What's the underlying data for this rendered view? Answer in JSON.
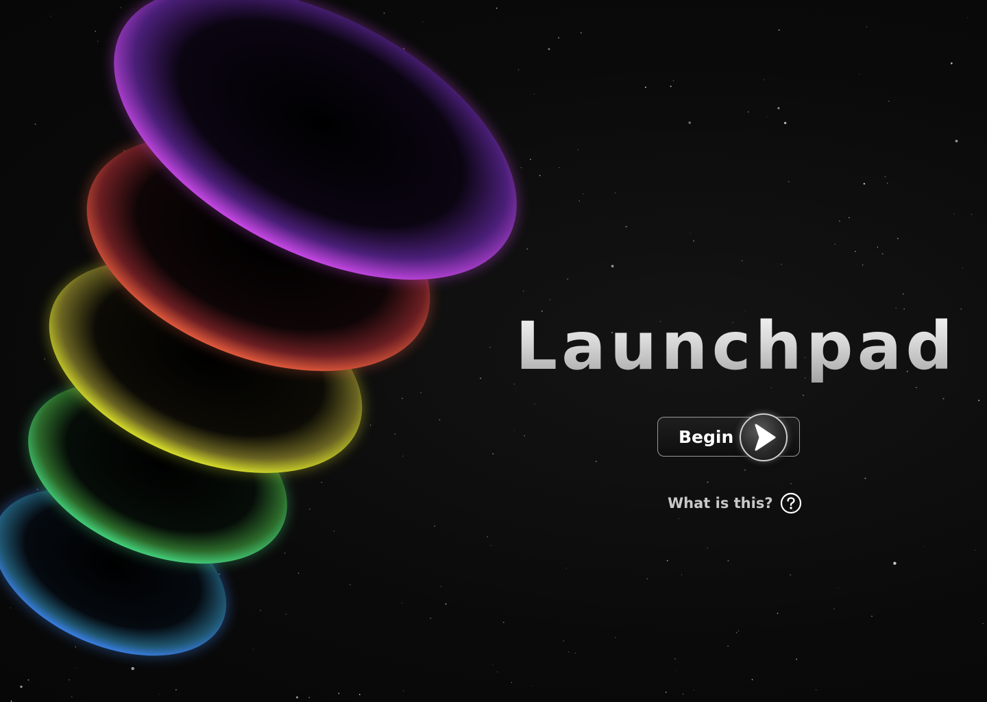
{
  "app": {
    "title": "Launchpad"
  },
  "actions": {
    "begin_label": "Begin",
    "help_label": "What is this?"
  },
  "icons": {
    "play": "play-arrow-icon",
    "help": "question-circle-icon"
  },
  "colors": {
    "background": "#0b0b0b",
    "ring_purple": "#c23fe0",
    "ring_red": "#e0503a",
    "ring_yellow": "#d8df2a",
    "ring_green": "#3bd57a",
    "ring_blue": "#3a7fe6",
    "title": "#e6e6e6"
  }
}
